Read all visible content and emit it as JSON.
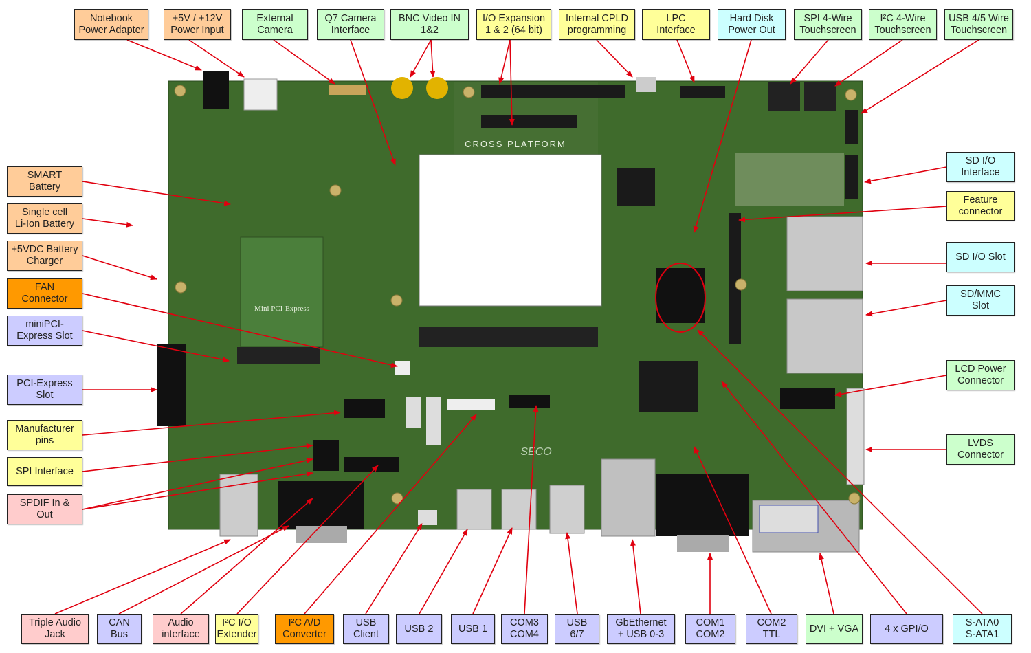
{
  "palette": {
    "light_orange": "#ffcc99",
    "orange": "#ff9900",
    "light_green": "#ccffcc",
    "yellow": "#ffff99",
    "cyan": "#ccffff",
    "lavender": "#ccccff",
    "pink": "#ffcccc",
    "arrow": "#e0000f",
    "board": "#3f6b2c"
  },
  "board": {
    "silkscreen_title": "CROSS PLATFORM",
    "mini_pci_label": "Mini PCI-Express",
    "brand": "SECO"
  },
  "labels": [
    {
      "id": "notebook-power-adapter",
      "lines": [
        "Notebook",
        "Power Adapter"
      ],
      "color": "#ffcc99"
    },
    {
      "id": "power-input",
      "lines": [
        "+5V / +12V",
        "Power Input"
      ],
      "color": "#ffcc99"
    },
    {
      "id": "external-camera",
      "lines": [
        "External",
        "Camera"
      ],
      "color": "#ccffcc"
    },
    {
      "id": "q7-camera-interface",
      "lines": [
        "Q7 Camera",
        "Interface"
      ],
      "color": "#ccffcc"
    },
    {
      "id": "bnc-video-in",
      "lines": [
        "BNC Video IN",
        "1&2"
      ],
      "color": "#ccffcc"
    },
    {
      "id": "io-expansion",
      "lines": [
        "I/O Expansion",
        "1 & 2 (64 bit)"
      ],
      "color": "#ffff99"
    },
    {
      "id": "cpld-programming",
      "lines": [
        "Internal CPLD",
        "programming"
      ],
      "color": "#ffff99"
    },
    {
      "id": "lpc-interface",
      "lines": [
        "LPC",
        "Interface"
      ],
      "color": "#ffff99"
    },
    {
      "id": "hdd-power-out",
      "lines": [
        "Hard Disk",
        "Power Out"
      ],
      "color": "#ccffff"
    },
    {
      "id": "spi-touchscreen",
      "lines": [
        "SPI 4-Wire",
        "Touchscreen"
      ],
      "color": "#ccffcc"
    },
    {
      "id": "i2c-touchscreen",
      "lines": [
        "I²C 4-Wire",
        "Touchscreen"
      ],
      "color": "#ccffcc"
    },
    {
      "id": "usb-touchscreen",
      "lines": [
        "USB 4/5 Wire",
        "Touchscreen"
      ],
      "color": "#ccffcc"
    },
    {
      "id": "smart-battery",
      "lines": [
        "SMART",
        "Battery"
      ],
      "color": "#ffcc99"
    },
    {
      "id": "li-ion-battery",
      "lines": [
        "Single cell",
        "Li-Ion Battery"
      ],
      "color": "#ffcc99"
    },
    {
      "id": "battery-charger",
      "lines": [
        "+5VDC Battery",
        "Charger"
      ],
      "color": "#ffcc99"
    },
    {
      "id": "fan-connector",
      "lines": [
        "FAN",
        "Connector"
      ],
      "color": "#ff9900"
    },
    {
      "id": "minipci-slot",
      "lines": [
        "miniPCI-",
        "Express Slot"
      ],
      "color": "#ccccff"
    },
    {
      "id": "pci-express-slot",
      "lines": [
        "PCI-Express",
        "Slot"
      ],
      "color": "#ccccff"
    },
    {
      "id": "manufacturer-pins",
      "lines": [
        "Manufacturer",
        "pins"
      ],
      "color": "#ffff99"
    },
    {
      "id": "spi-interface",
      "lines": [
        "SPI Interface"
      ],
      "color": "#ffff99"
    },
    {
      "id": "spdif",
      "lines": [
        "SPDIF In &",
        "Out"
      ],
      "color": "#ffcccc"
    },
    {
      "id": "sd-io-interface",
      "lines": [
        "SD I/O",
        "Interface"
      ],
      "color": "#ccffff"
    },
    {
      "id": "feature-connector",
      "lines": [
        "Feature",
        "connector"
      ],
      "color": "#ffff99"
    },
    {
      "id": "sd-io-slot",
      "lines": [
        "SD I/O Slot"
      ],
      "color": "#ccffff"
    },
    {
      "id": "sd-mmc-slot",
      "lines": [
        "SD/MMC",
        "Slot"
      ],
      "color": "#ccffff"
    },
    {
      "id": "lcd-power-connector",
      "lines": [
        "LCD Power",
        "Connector"
      ],
      "color": "#ccffcc"
    },
    {
      "id": "lvds-connector",
      "lines": [
        "LVDS",
        "Connector"
      ],
      "color": "#ccffcc"
    },
    {
      "id": "triple-audio-jack",
      "lines": [
        "Triple Audio",
        "Jack"
      ],
      "color": "#ffcccc"
    },
    {
      "id": "can-bus",
      "lines": [
        "CAN",
        "Bus"
      ],
      "color": "#ccccff"
    },
    {
      "id": "audio-interface",
      "lines": [
        "Audio",
        "interface"
      ],
      "color": "#ffcccc"
    },
    {
      "id": "i2c-io-extender",
      "lines": [
        "I²C I/O",
        "Extender"
      ],
      "color": "#ffff99"
    },
    {
      "id": "i2c-ad-converter",
      "lines": [
        "I²C A/D",
        "Converter"
      ],
      "color": "#ff9900"
    },
    {
      "id": "usb-client",
      "lines": [
        "USB",
        "Client"
      ],
      "color": "#ccccff"
    },
    {
      "id": "usb-2",
      "lines": [
        "USB 2"
      ],
      "color": "#ccccff"
    },
    {
      "id": "usb-1",
      "lines": [
        "USB 1"
      ],
      "color": "#ccccff"
    },
    {
      "id": "com3-com4",
      "lines": [
        "COM3",
        "COM4"
      ],
      "color": "#ccccff"
    },
    {
      "id": "usb-6-7",
      "lines": [
        "USB",
        "6/7"
      ],
      "color": "#ccccff"
    },
    {
      "id": "gbethernet-usb",
      "lines": [
        "GbEthernet",
        "+ USB 0-3"
      ],
      "color": "#ccccff"
    },
    {
      "id": "com1-com2",
      "lines": [
        "COM1",
        "COM2"
      ],
      "color": "#ccccff"
    },
    {
      "id": "com2-ttl",
      "lines": [
        "COM2",
        "TTL"
      ],
      "color": "#ccccff"
    },
    {
      "id": "dvi-vga",
      "lines": [
        "DVI + VGA"
      ],
      "color": "#ccffcc"
    },
    {
      "id": "gpio",
      "lines": [
        "4 x GPI/O"
      ],
      "color": "#ccccff"
    },
    {
      "id": "sata",
      "lines": [
        "S-ATA0",
        "S-ATA1"
      ],
      "color": "#ccffff"
    }
  ]
}
